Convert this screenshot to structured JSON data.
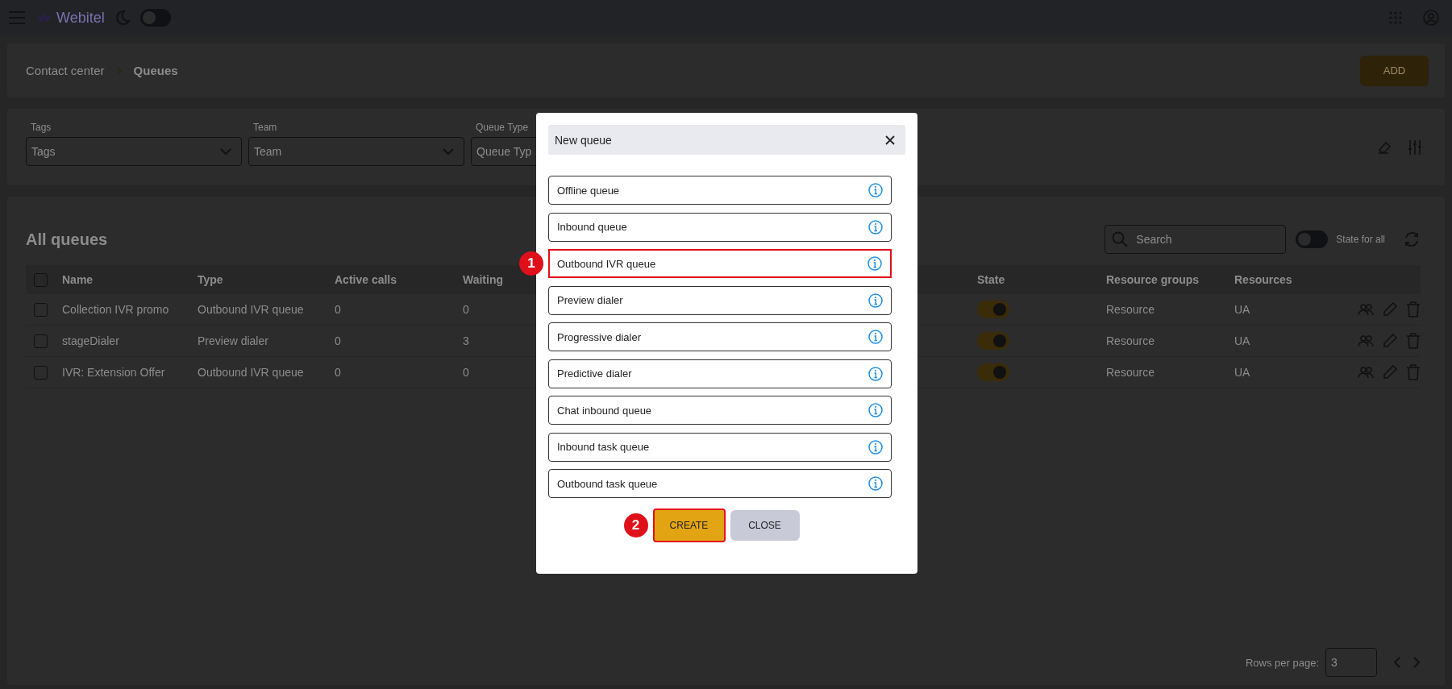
{
  "header": {
    "logo": "Webitel",
    "theme_toggle": {
      "on": false
    }
  },
  "breadcrumb": [
    {
      "label": "Contact center",
      "current": false
    },
    {
      "label": "Queues",
      "current": true
    }
  ],
  "add_button": "ADD",
  "filters": [
    {
      "label": "Tags",
      "placeholder": "Tags"
    },
    {
      "label": "Team",
      "placeholder": "Team"
    },
    {
      "label": "Queue Type",
      "placeholder": "Queue Typ"
    }
  ],
  "table": {
    "title": "All queues",
    "all_checked": false,
    "search": {
      "placeholder": "Search"
    },
    "state_for_all": {
      "label": "State for all",
      "on": false
    },
    "columns": [
      "Name",
      "Type",
      "Active calls",
      "Waiting",
      "State",
      "Resource groups",
      "Resources"
    ],
    "rows": [
      {
        "checked": false,
        "name": "Collection IVR promo",
        "type": "Outbound IVR queue",
        "active_calls": "0",
        "waiting": "0",
        "state_on": true,
        "resource_groups": "Resource",
        "resources": "UA"
      },
      {
        "checked": false,
        "name": "stageDialer",
        "type": "Preview dialer",
        "active_calls": "0",
        "waiting": "3",
        "state_on": true,
        "resource_groups": "Resource",
        "resources": "UA"
      },
      {
        "checked": false,
        "name": "IVR: Extension Offer",
        "type": "Outbound IVR queue",
        "active_calls": "0",
        "waiting": "0",
        "state_on": true,
        "resource_groups": "Resource",
        "resources": "UA"
      }
    ]
  },
  "pagination": {
    "label": "Rows per page:",
    "value": "3"
  },
  "dialog": {
    "title": "New queue",
    "options": [
      {
        "label": "Offline queue",
        "selected": false
      },
      {
        "label": "Inbound queue",
        "selected": false
      },
      {
        "label": "Outbound IVR queue",
        "selected": true,
        "callout": "1"
      },
      {
        "label": "Preview dialer",
        "selected": false
      },
      {
        "label": "Progressive dialer",
        "selected": false
      },
      {
        "label": "Predictive dialer",
        "selected": false
      },
      {
        "label": "Chat inbound queue",
        "selected": false
      },
      {
        "label": "Inbound task queue",
        "selected": false
      },
      {
        "label": "Outbound task queue",
        "selected": false
      }
    ],
    "buttons": [
      {
        "label": "CREATE",
        "kind": "primary",
        "highlighted": true,
        "callout": "2"
      },
      {
        "label": "CLOSE",
        "kind": "secondary",
        "highlighted": false
      }
    ]
  }
}
